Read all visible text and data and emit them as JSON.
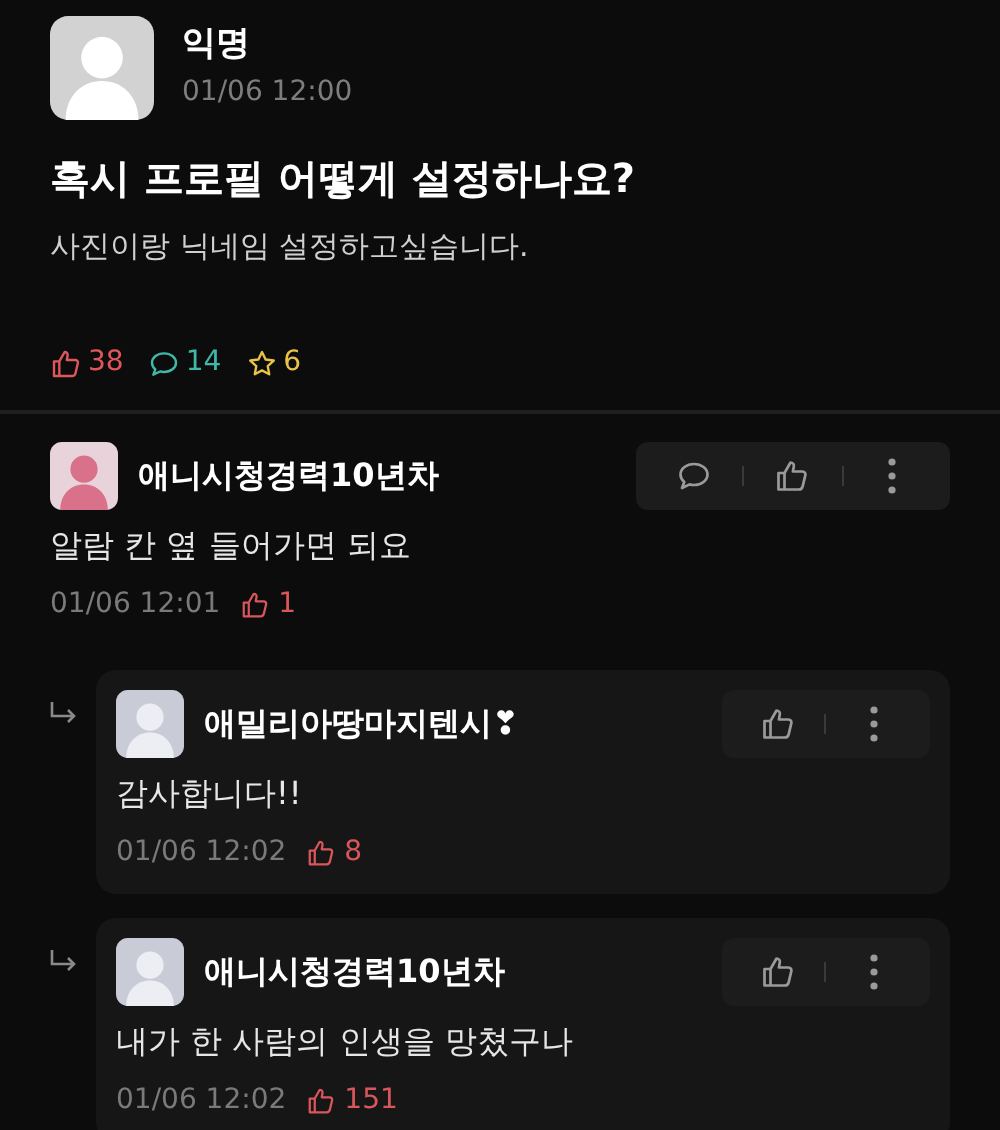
{
  "post": {
    "author": "익명",
    "date": "01/06 12:00",
    "title": "혹시 프로필 어떻게 설정하나요?",
    "body": "사진이랑 닉네임 설정하고싶습니다.",
    "stats": [
      {
        "kind": "like",
        "count": "38",
        "color": "#e0575b"
      },
      {
        "kind": "comment",
        "count": "14",
        "color": "#3fb8a9"
      },
      {
        "kind": "scrap",
        "count": "6",
        "color": "#e8c249"
      }
    ]
  },
  "comments": [
    {
      "author": "애니시청경력10년차",
      "text": "알람 칸 옆 들어가면 되요",
      "date": "01/06 12:01",
      "likes": "1",
      "children": [
        {
          "author": "애밀리아땅마지텐시❣",
          "text": "감사합니다!!",
          "date": "01/06 12:02",
          "likes": "8"
        },
        {
          "author": "애니시청경력10년차",
          "text": "내가 한 사람의 인생을 망쳤구나",
          "date": "01/06 12:02",
          "likes": "151"
        }
      ]
    }
  ]
}
